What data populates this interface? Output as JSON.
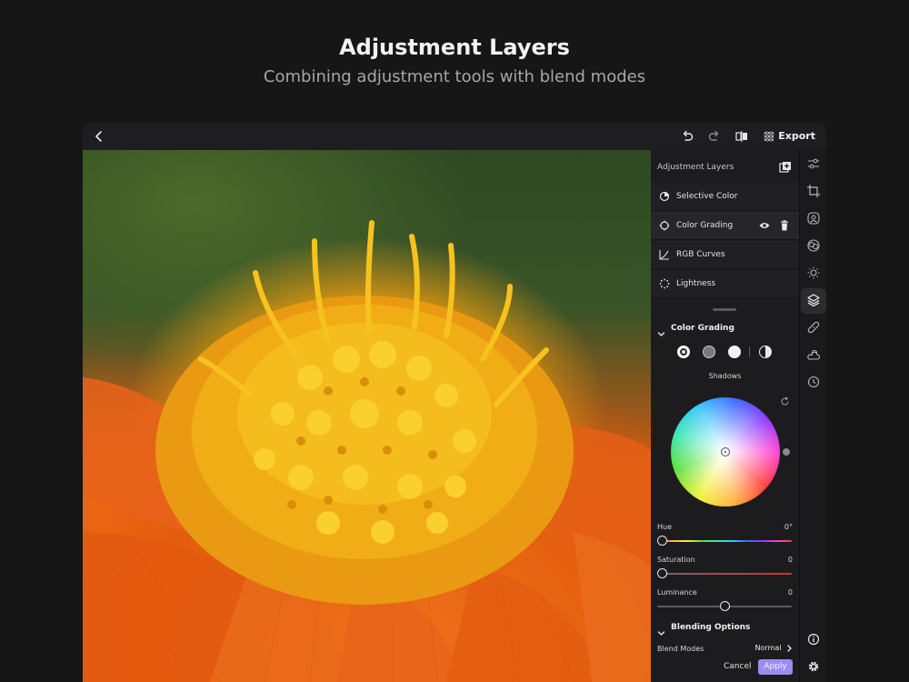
{
  "hero": {
    "title": "Adjustment Layers",
    "subtitle": "Combining adjustment tools with blend modes"
  },
  "topbar": {
    "export_label": "Export",
    "icons": [
      "back-icon",
      "undo-icon",
      "redo-icon",
      "compare-icon",
      "grid-icon"
    ]
  },
  "panel": {
    "title": "Adjustment Layers",
    "layers": [
      {
        "label": "Selective Color",
        "icon": "selective-color-icon"
      },
      {
        "label": "Color Grading",
        "icon": "color-grading-icon"
      },
      {
        "label": "RGB Curves",
        "icon": "curves-icon"
      },
      {
        "label": "Lightness",
        "icon": "lightness-icon"
      }
    ],
    "color_grading": {
      "title": "Color Grading",
      "mode_label": "Shadows",
      "hue_label": "Hue",
      "hue_value": "0°",
      "saturation_label": "Saturation",
      "saturation_value": "0",
      "luminance_label": "Luminance",
      "luminance_value": "0",
      "hue_level": 0,
      "saturation_level": 0,
      "luminance_level": 0.5
    },
    "blending": {
      "title": "Blending Options",
      "blend_modes_label": "Blend Modes",
      "blend_mode_value": "Normal"
    },
    "cancel_label": "Cancel",
    "apply_label": "Apply"
  },
  "toolrail": {
    "icons": [
      "sliders-icon",
      "crop-icon",
      "portrait-icon",
      "effects-icon",
      "light-icon",
      "layers-icon",
      "healing-icon",
      "weather-icon",
      "history-icon",
      "info-icon",
      "settings-icon"
    ],
    "active": "layers-icon"
  },
  "colors": {
    "accent": "#9b8cf0",
    "background": "#161616",
    "panel": "#1c1c1e"
  }
}
